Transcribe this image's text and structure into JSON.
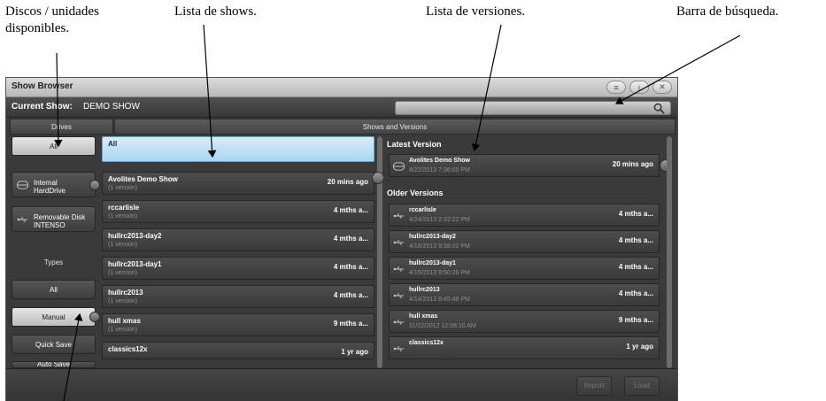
{
  "annotations": {
    "drives_line1": "Discos / unidades",
    "drives_line2": "disponibles.",
    "shows": "Lista de shows.",
    "versions": "Lista de versiones.",
    "search": "Barra de búsqueda."
  },
  "window": {
    "title": "Show Browser",
    "title_buttons": [
      "list-icon",
      "info-icon",
      "close-icon"
    ]
  },
  "current_show": {
    "label": "Current Show:",
    "value": "DEMO SHOW"
  },
  "search": {
    "placeholder": ""
  },
  "headers": {
    "drives": "Drives",
    "shows_versions": "Shows and Versions"
  },
  "drives": [
    {
      "label": "All",
      "selected": true
    },
    {
      "line1": "Internal",
      "line2": "HardDrive",
      "icon": "drive-icon"
    },
    {
      "line1": "Removable Disk",
      "line2": "INTENSO",
      "icon": "usb-icon"
    }
  ],
  "types_label": "Types",
  "types": [
    {
      "label": "All"
    },
    {
      "label": "Manual",
      "selected": true
    },
    {
      "label": "Quick Save"
    },
    {
      "label": "Auto Save"
    }
  ],
  "shows": [
    {
      "name": "All",
      "sub": "",
      "age": "",
      "selected": true
    },
    {
      "name": "Avolites Demo Show",
      "sub": "(1 version)",
      "age": "20 mins ago"
    },
    {
      "name": "rccarlisle",
      "sub": "(1 version)",
      "age": "4 mths a..."
    },
    {
      "name": "hullrc2013-day2",
      "sub": "(1 version)",
      "age": "4 mths a..."
    },
    {
      "name": "hullrc2013-day1",
      "sub": "(1 version)",
      "age": "4 mths a..."
    },
    {
      "name": "hullrc2013",
      "sub": "(1 version)",
      "age": "4 mths a..."
    },
    {
      "name": "hull xmas",
      "sub": "(1 version)",
      "age": "9 mths a..."
    },
    {
      "name": "classics12x",
      "sub": "",
      "age": "1 yr ago"
    }
  ],
  "latest_version_label": "Latest Version",
  "latest_version": {
    "name": "Avolites Demo Show",
    "date": "8/22/2013 7:36:05 PM",
    "age": "20 mins ago",
    "icon": "drive-icon"
  },
  "older_versions_label": "Older Versions",
  "older_versions": [
    {
      "name": "rccarlisle",
      "date": "4/24/2013 2:32:22 PM",
      "age": "4 mths a...",
      "icon": "usb-icon"
    },
    {
      "name": "hullrc2013-day2",
      "date": "4/16/2013 9:38:02 PM",
      "age": "4 mths a...",
      "icon": "usb-icon"
    },
    {
      "name": "hullrc2013-day1",
      "date": "4/15/2013 9:50:26 PM",
      "age": "4 mths a...",
      "icon": "usb-icon"
    },
    {
      "name": "hullrc2013",
      "date": "4/14/2013 8:45:48 PM",
      "age": "4 mths a...",
      "icon": "usb-icon"
    },
    {
      "name": "hull xmas",
      "date": "11/22/2012 12:08:10 AM",
      "age": "9 mths a...",
      "icon": "usb-icon"
    },
    {
      "name": "classics12x",
      "date": "",
      "age": "1 yr ago",
      "icon": "usb-icon"
    }
  ],
  "footer": {
    "import": "Import",
    "load": "Load"
  },
  "colors": {
    "selected_show": "#bfe3f8",
    "window_bg": "#3a3a3a",
    "selected_button": "#d6d6d6"
  }
}
